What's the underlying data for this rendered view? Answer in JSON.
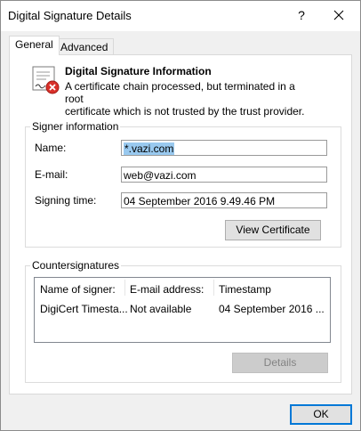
{
  "window": {
    "title": "Digital Signature Details",
    "help_glyph": "?",
    "close_glyph": "×"
  },
  "tabs": [
    {
      "label": "General",
      "selected": true
    },
    {
      "label": "Advanced",
      "selected": false
    }
  ],
  "info": {
    "icon": "certificate-error-icon",
    "title": "Digital Signature Information",
    "message_line1": "A certificate chain processed, but terminated in a root",
    "message_line2": "certificate which is not trusted by the trust provider."
  },
  "signer": {
    "group_label": "Signer information",
    "name_label": "Name:",
    "name_value": "*.vazi.com",
    "email_label": "E-mail:",
    "email_value": "web@vazi.com",
    "time_label": "Signing time:",
    "time_value": "04 September 2016 9.49.46 PM",
    "view_cert_label": "View Certificate"
  },
  "countersignatures": {
    "group_label": "Countersignatures",
    "columns": [
      "Name of signer:",
      "E-mail address:",
      "Timestamp"
    ],
    "rows": [
      [
        "DigiCert Timesta...",
        "Not available",
        "04 September 2016 ..."
      ]
    ],
    "details_label": "Details"
  },
  "footer": {
    "ok_label": "OK"
  }
}
